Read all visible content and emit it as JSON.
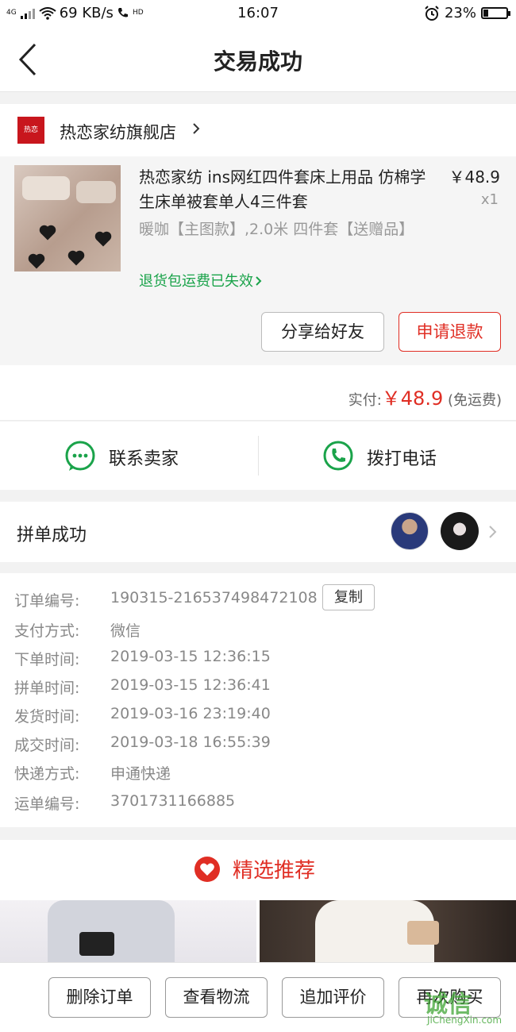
{
  "status_bar": {
    "network": "4G",
    "speed": "69 KB/s",
    "hd": "HD",
    "time": "16:07",
    "battery": "23%",
    "battery_level": 0.23
  },
  "nav": {
    "title": "交易成功"
  },
  "store": {
    "logo_text": "热恋",
    "name": "热恋家纺旗舰店"
  },
  "product": {
    "title": "热恋家纺 ins网红四件套床上用品 仿棉学生床单被套单人4三件套",
    "price": "￥48.9",
    "quantity": "x1",
    "spec": "暖咖【主图款】,2.0米 四件套【送赠品】",
    "refund_note": "退货包运费已失效",
    "share_label": "分享给好友",
    "refund_label": "申请退款"
  },
  "payment": {
    "paid_label": "实付:",
    "paid_amount": "￥48.9",
    "shipping_note": "(免运费)"
  },
  "contact": {
    "seller_label": "联系卖家",
    "call_label": "拨打电话"
  },
  "group": {
    "label": "拼单成功"
  },
  "order_info": {
    "rows": [
      {
        "label": "订单编号:",
        "value": "190315-216537498472108"
      },
      {
        "label": "支付方式:",
        "value": "微信"
      },
      {
        "label": "下单时间:",
        "value": "2019-03-15 12:36:15"
      },
      {
        "label": "拼单时间:",
        "value": "2019-03-15 12:36:41"
      },
      {
        "label": "发货时间:",
        "value": "2019-03-16 23:19:40"
      },
      {
        "label": "成交时间:",
        "value": "2019-03-18 16:55:39"
      },
      {
        "label": "快递方式:",
        "value": "申通快递"
      },
      {
        "label": "运单编号:",
        "value": "3701731166885"
      }
    ],
    "copy_label": "复制"
  },
  "recommend": {
    "label": "精选推荐"
  },
  "bottom_actions": [
    "删除订单",
    "查看物流",
    "追加评价",
    "再次购买"
  ],
  "watermark": {
    "main": "诚信",
    "sub": "JiChengXin.com"
  },
  "colors": {
    "accent_red": "#e02e24",
    "green": "#1aa34a",
    "brand_red": "#c8161d"
  }
}
